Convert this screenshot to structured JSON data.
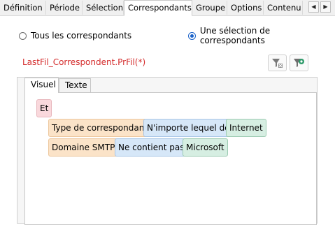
{
  "tabs": [
    "Définition",
    "Période",
    "Sélection",
    "Correspondants",
    "Groupe",
    "Options",
    "Contenu"
  ],
  "active_tab": "Correspondants",
  "scroll_left": "◀",
  "scroll_right": "▶",
  "radio_all": "Tous les correspondants",
  "radio_selection": "Une sélection de correspondants",
  "variable_name": "LastFil_Correspondent.PrFil(*)",
  "editor_tabs": {
    "visual": "Visuel",
    "text": "Texte"
  },
  "logic_operator": "Et",
  "conditions": [
    {
      "field": "Type de correspondant",
      "operator": "N'importe lequel de",
      "value": "Internet"
    },
    {
      "field": "Domaine SMTP",
      "operator": "Ne contient pas",
      "value": "Microsoft"
    }
  ],
  "colors": {
    "accent": "#1a62c9",
    "variable_text": "#d42b2b",
    "logic_chip": "#f9d8dc",
    "field_chip": "#fbe3c8",
    "operator_chip": "#d6e7f8",
    "value_chip": "#d6eee2"
  }
}
